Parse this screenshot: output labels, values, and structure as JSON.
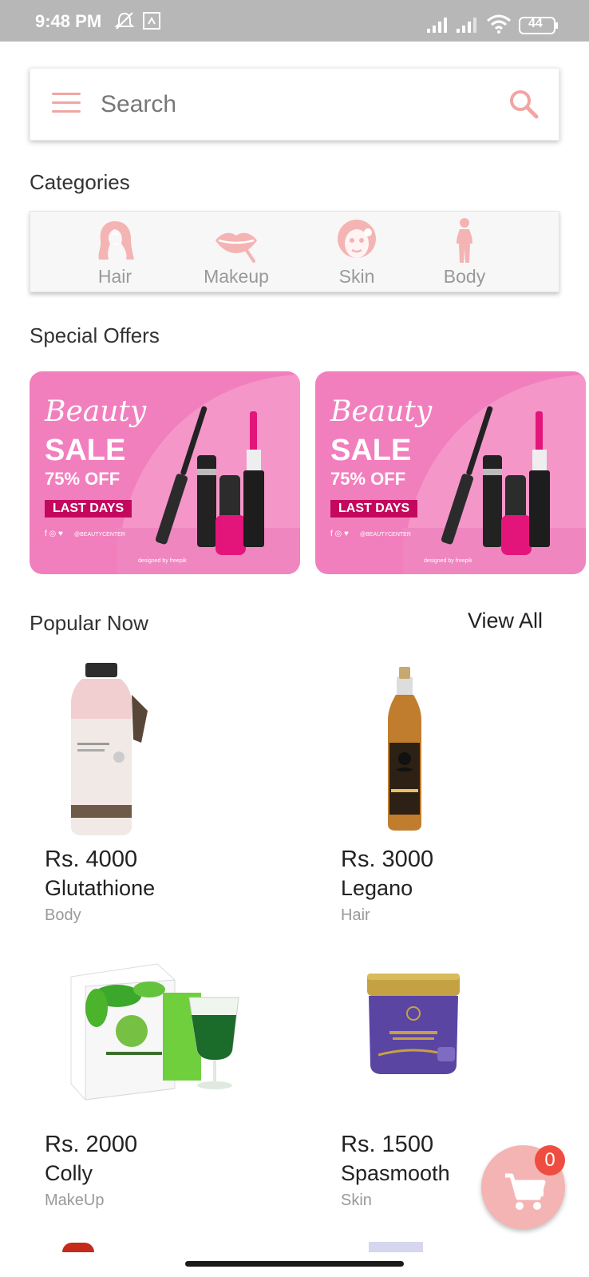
{
  "status_bar": {
    "time": "9:48 PM",
    "battery": "44",
    "icons": [
      "mute-icon",
      "screenshot-icon",
      "signal-icon",
      "signal-icon",
      "wifi-icon",
      "battery-icon"
    ]
  },
  "search": {
    "placeholder": "Search",
    "menu_icon": "hamburger-menu-icon",
    "search_icon": "magnifier-icon"
  },
  "categories": {
    "title": "Categories",
    "items": [
      {
        "label": "Hair",
        "icon": "hair-icon"
      },
      {
        "label": "Makeup",
        "icon": "lips-icon"
      },
      {
        "label": "Skin",
        "icon": "face-mask-icon"
      },
      {
        "label": "Body",
        "icon": "body-icon"
      }
    ]
  },
  "special_offers": {
    "title": "Special Offers",
    "banners": [
      {
        "script": "Beauty",
        "headline": "SALE",
        "discount": "75% OFF",
        "tag": "LAST DAYS",
        "handle": "@BEAUTYCENTER",
        "credit": "designed by freepik"
      },
      {
        "script": "Beauty",
        "headline": "SALE",
        "discount": "75% OFF",
        "tag": "LAST DAYS",
        "handle": "@BEAUTYCENTER",
        "credit": "designed by freepik"
      }
    ]
  },
  "popular": {
    "title": "Popular Now",
    "view_all": "View All",
    "products": [
      {
        "price": "Rs. 4000",
        "name": "Glutathione",
        "category": "Body"
      },
      {
        "price": "Rs. 3000",
        "name": "Legano",
        "category": "Hair"
      },
      {
        "price": "Rs. 2000",
        "name": "Colly",
        "category": "MakeUp"
      },
      {
        "price": "Rs. 1500",
        "name": "Spasmooth",
        "category": "Skin"
      }
    ]
  },
  "cart": {
    "count": "0",
    "icon": "cart-icon"
  },
  "colors": {
    "accent": "#f0a6a3",
    "banner_pink": "#f27fbd",
    "badge_red": "#ef4d3f"
  }
}
